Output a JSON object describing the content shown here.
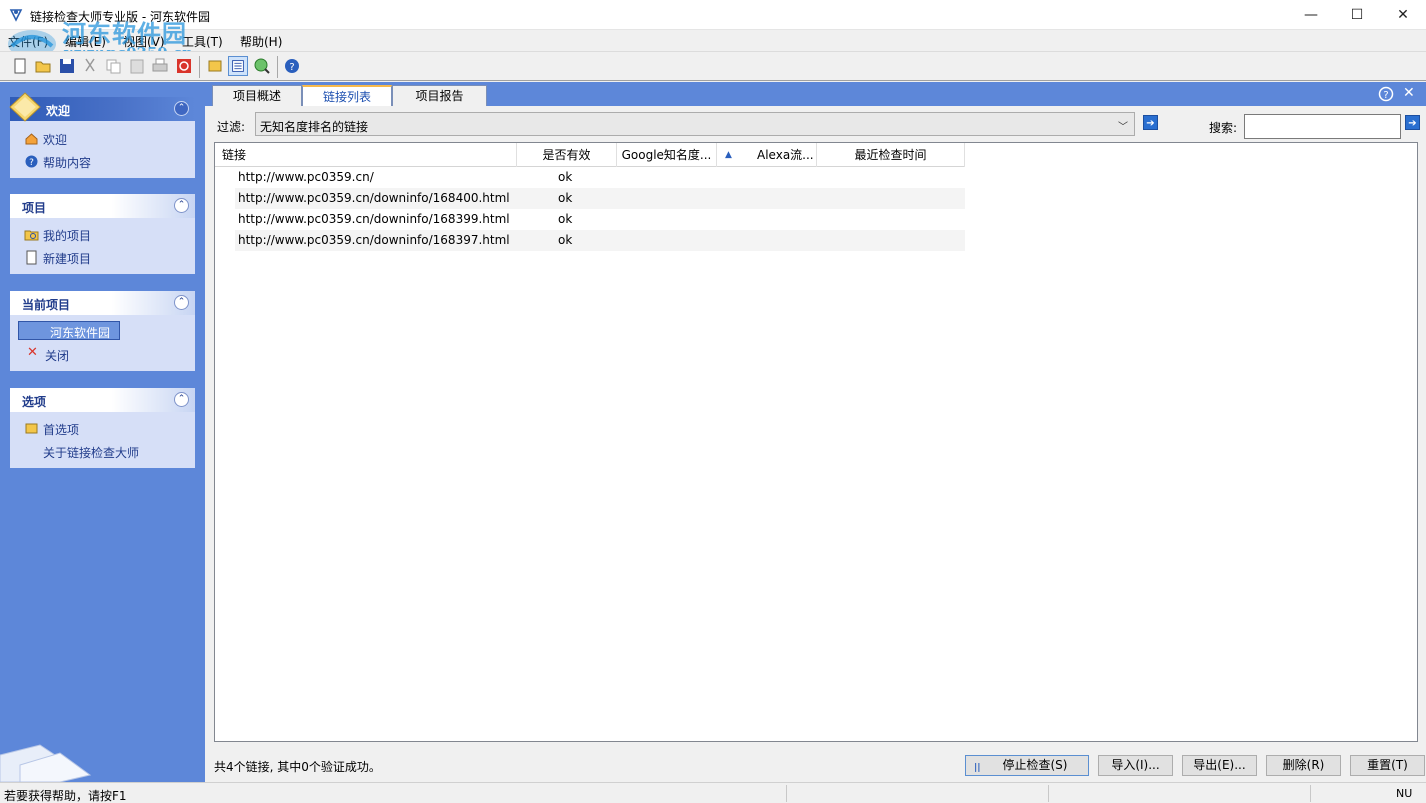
{
  "window": {
    "title": "链接检查大师专业版 - 河东软件园",
    "minimize": "—",
    "maximize": "☐",
    "close": "✕"
  },
  "watermark": {
    "line1": "河东软件园",
    "line2": "www.pc0359.cn"
  },
  "menu": [
    "文件(F)",
    "编辑(E)",
    "视图(V)",
    "工具(T)",
    "帮助(H)"
  ],
  "toolbar": {
    "buttons": [
      "new-icon",
      "open-icon",
      "save-icon",
      "cut-icon",
      "copy-icon",
      "paste-icon",
      "print-icon",
      "stop-icon",
      "preferences-icon",
      "list-view-icon",
      "check-icon",
      "help-icon"
    ]
  },
  "sidebar": {
    "welcome": {
      "title": "欢迎",
      "items": [
        "欢迎",
        "帮助内容"
      ]
    },
    "project": {
      "title": "项目",
      "items": [
        "我的项目",
        "新建项目"
      ]
    },
    "current": {
      "title": "当前项目",
      "selected": "河东软件园",
      "close": "关闭"
    },
    "options": {
      "title": "选项",
      "items": [
        "首选项",
        "关于链接检查大师"
      ]
    }
  },
  "tabs": [
    "项目概述",
    "链接列表",
    "项目报告"
  ],
  "filter": {
    "label": "过滤:",
    "value": "无知名度排名的链接"
  },
  "search": {
    "label": "搜索:",
    "value": ""
  },
  "table": {
    "columns": [
      "链接",
      "是否有效",
      "Google知名度...",
      "Alexa流...",
      "最近检查时间"
    ],
    "rows": [
      {
        "url": "http://www.pc0359.cn/",
        "status": "ok"
      },
      {
        "url": "http://www.pc0359.cn/downinfo/168400.html",
        "status": "ok"
      },
      {
        "url": "http://www.pc0359.cn/downinfo/168399.html",
        "status": "ok"
      },
      {
        "url": "http://www.pc0359.cn/downinfo/168397.html",
        "status": "ok"
      }
    ]
  },
  "summary": "共4个链接, 其中0个验证成功。",
  "buttons": {
    "stop": "停止检查(S)",
    "import": "导入(I)...",
    "export": "导出(E)...",
    "delete": "删除(R)",
    "reset": "重置(T)"
  },
  "status": {
    "help": "若要获得帮助，请按F1",
    "num": "NU"
  },
  "colors": {
    "panel": "#5d87d9",
    "group": "#d6dff7",
    "accent_tab": "#f7b94b"
  }
}
